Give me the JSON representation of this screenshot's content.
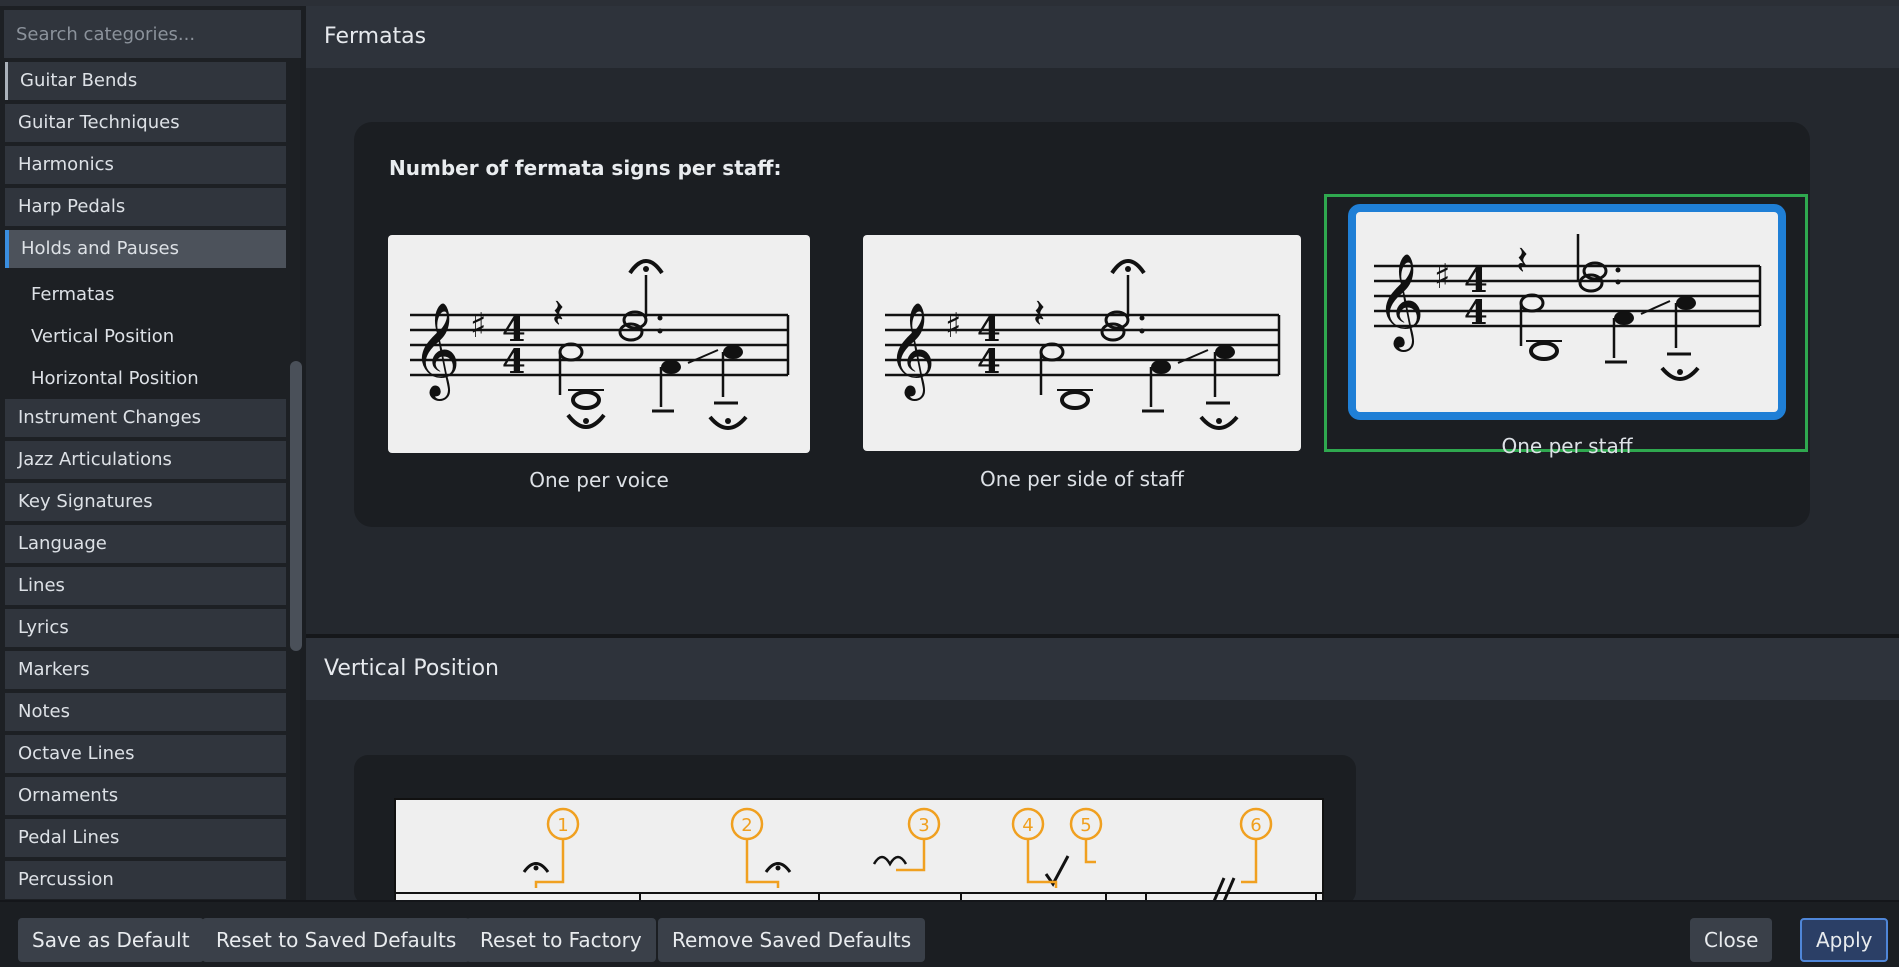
{
  "search": {
    "placeholder": "Search categories..."
  },
  "sidebar": {
    "items": [
      {
        "label": "Guitar Bends"
      },
      {
        "label": "Guitar Techniques"
      },
      {
        "label": "Harmonics"
      },
      {
        "label": "Harp Pedals"
      },
      {
        "label": "Holds and Pauses",
        "selected": true
      },
      {
        "label": "Fermatas"
      },
      {
        "label": "Vertical Position"
      },
      {
        "label": "Horizontal Position"
      },
      {
        "label": "Instrument Changes"
      },
      {
        "label": "Jazz Articulations"
      },
      {
        "label": "Key Signatures"
      },
      {
        "label": "Language"
      },
      {
        "label": "Lines"
      },
      {
        "label": "Lyrics"
      },
      {
        "label": "Markers"
      },
      {
        "label": "Notes"
      },
      {
        "label": "Octave Lines"
      },
      {
        "label": "Ornaments"
      },
      {
        "label": "Pedal Lines"
      },
      {
        "label": "Percussion"
      }
    ]
  },
  "sections": {
    "fermatas": {
      "title": "Fermatas",
      "question": "Number of fermata signs per staff:",
      "options": [
        {
          "label": "One per voice"
        },
        {
          "label": "One per side of staff"
        },
        {
          "label": "One per staff",
          "selected": true
        }
      ]
    },
    "vertical": {
      "title": "Vertical Position",
      "callouts": [
        "1",
        "2",
        "3",
        "4",
        "5",
        "6"
      ]
    }
  },
  "footer": {
    "save_default": "Save as Default",
    "reset_saved": "Reset to Saved Defaults",
    "reset_factory": "Reset to Factory",
    "remove_saved": "Remove Saved Defaults",
    "close": "Close",
    "apply": "Apply"
  },
  "colors": {
    "accent": "#1f7fd6",
    "selected_frame": "#2fa84f",
    "callout": "#f0a020"
  }
}
